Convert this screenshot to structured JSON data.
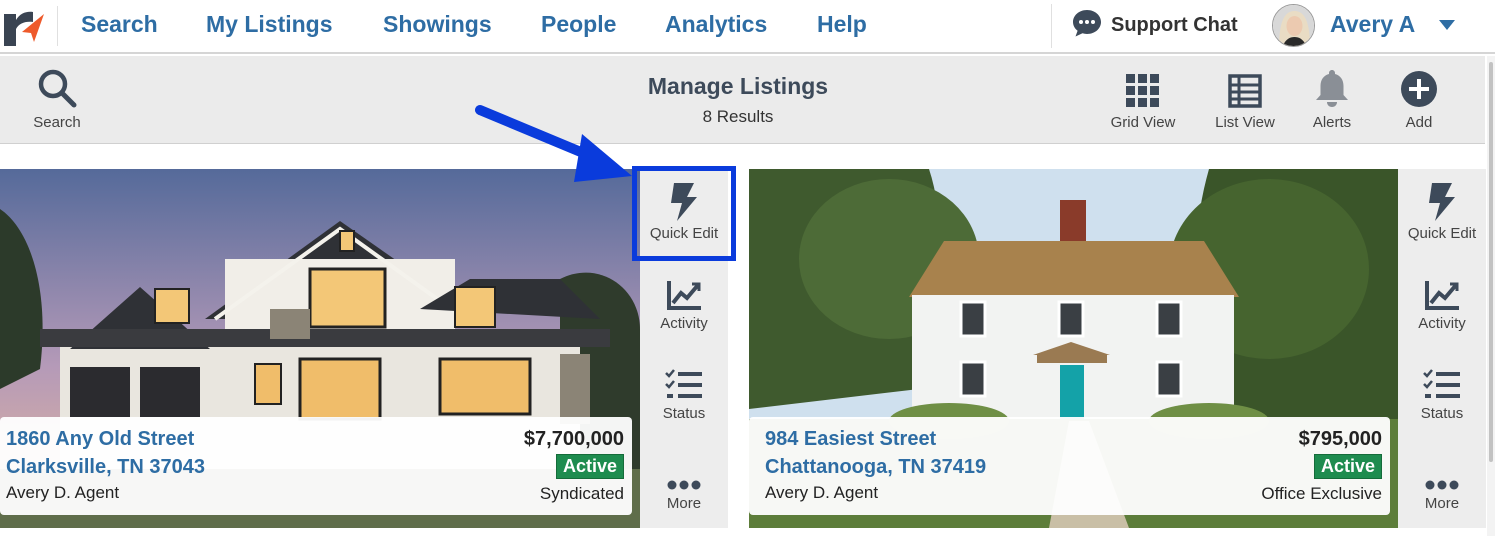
{
  "nav": {
    "items": [
      "Search",
      "My Listings",
      "Showings",
      "People",
      "Analytics",
      "Help"
    ],
    "support_label": "Support Chat",
    "user_name": "Avery A"
  },
  "toolbar": {
    "search_label": "Search",
    "title": "Manage Listings",
    "results": "8 Results",
    "grid_label": "Grid View",
    "list_label": "List View",
    "alerts_label": "Alerts",
    "add_label": "Add"
  },
  "actions": {
    "quick_edit": "Quick Edit",
    "activity": "Activity",
    "status": "Status",
    "more": "More"
  },
  "listings": [
    {
      "address1": "1860 Any Old Street",
      "address2": "Clarksville, TN 37043",
      "agent": "Avery D. Agent",
      "price": "$7,700,000",
      "status": "Active",
      "distribution": "Syndicated"
    },
    {
      "address1": "984 Easiest Street",
      "address2": "Chattanooga, TN 37419",
      "agent": "Avery D. Agent",
      "price": "$795,000",
      "status": "Active",
      "distribution": "Office Exclusive"
    }
  ],
  "colors": {
    "brand_blue": "#2e6da4",
    "active_green": "#1e8c4f",
    "highlight_blue": "#0a3bdc",
    "logo_orange": "#ee5a2b"
  }
}
